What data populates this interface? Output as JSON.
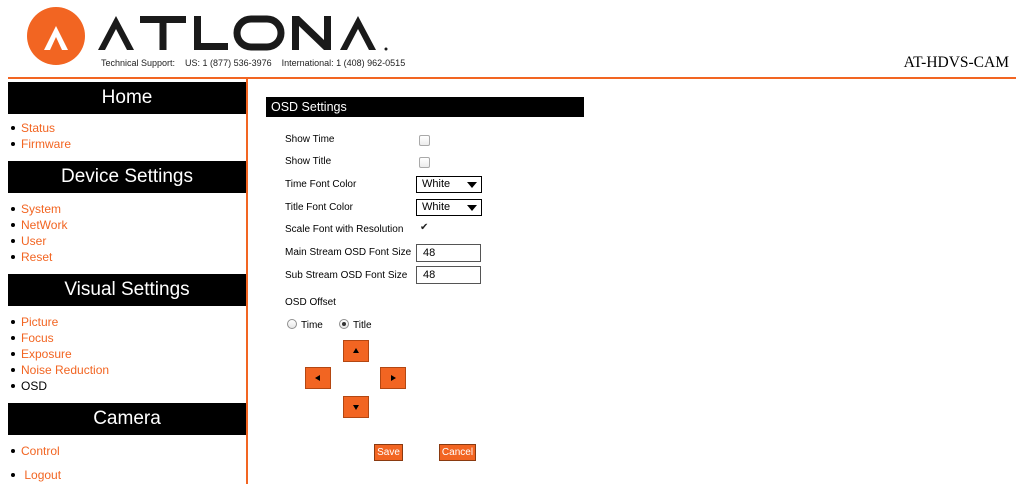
{
  "header": {
    "brand": "ATLONA",
    "support_label": "Technical Support:",
    "support_us": "US: 1 (877) 536-3976",
    "support_intl": "International: 1 (408) 962-0515",
    "model": "AT-HDVS-CAM",
    "accent_color": "#f26522"
  },
  "sidebar": {
    "sections": [
      {
        "title": "Home",
        "items": [
          "Status",
          "Firmware"
        ]
      },
      {
        "title": "Device Settings",
        "items": [
          "System",
          "NetWork",
          "User",
          "Reset"
        ]
      },
      {
        "title": "Visual Settings",
        "items": [
          "Picture",
          "Focus",
          "Exposure",
          "Noise Reduction",
          "OSD"
        ],
        "current": "OSD"
      },
      {
        "title": "Camera",
        "items": [
          "Control"
        ]
      }
    ],
    "logout": "Logout"
  },
  "osd": {
    "title": "OSD Settings",
    "show_time": {
      "label": "Show Time",
      "checked": false
    },
    "show_title": {
      "label": "Show Title",
      "checked": false
    },
    "time_font_color": {
      "label": "Time Font Color",
      "value": "White"
    },
    "title_font_color": {
      "label": "Title Font Color",
      "value": "White"
    },
    "scale_font": {
      "label": "Scale Font with Resolution",
      "checked": true
    },
    "main_stream_size": {
      "label": "Main Stream OSD Font Size",
      "value": "48"
    },
    "sub_stream_size": {
      "label": "Sub Stream OSD Font Size",
      "value": "48"
    },
    "offset": {
      "label": "OSD Offset",
      "options": [
        "Time",
        "Title"
      ],
      "selected": "Title",
      "directions": [
        "up",
        "left",
        "right",
        "down"
      ]
    },
    "save_label": "Save",
    "cancel_label": "Cancel"
  }
}
